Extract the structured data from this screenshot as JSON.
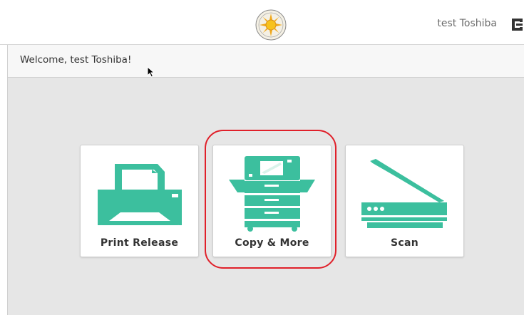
{
  "header": {
    "user_name": "test Toshiba",
    "logo_icon": "sun-seal-logo",
    "logout_icon": "logout-icon"
  },
  "welcome": {
    "message": "Welcome, test Toshiba!"
  },
  "tiles": [
    {
      "label": "Print Release",
      "icon": "printer-icon"
    },
    {
      "label": "Copy & More",
      "icon": "copier-icon"
    },
    {
      "label": "Scan",
      "icon": "scanner-icon"
    }
  ],
  "colors": {
    "accent": "#3cbf9e",
    "highlight": "#e0202a",
    "background": "#e6e6e6"
  }
}
